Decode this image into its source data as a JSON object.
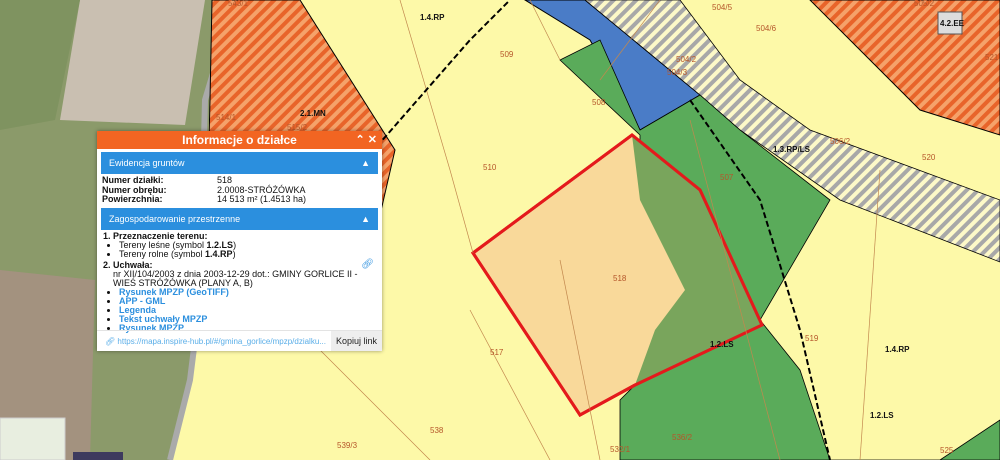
{
  "panel": {
    "title": "Informacje o działce",
    "controls": "⌃✕",
    "ewidencja": {
      "header": "Ewidencja gruntów",
      "rows": [
        {
          "key": "Numer działki:",
          "value": "518"
        },
        {
          "key": "Numer obrębu:",
          "value": "2.0008-STRÓŻÓWKA"
        },
        {
          "key": "Powierzchnia:",
          "value": "14 513 m² (1.4513 ha)"
        }
      ]
    },
    "zagospodarowanie": {
      "header": "Zagospodarowanie przestrzenne",
      "przeznaczenie_label": "1.  Przeznaczenie terenu:",
      "przeznaczenie": [
        {
          "text": "Tereny leśne (symbol ",
          "symbol": "1.2.LS",
          "end": ")"
        },
        {
          "text": "Tereny rolne (symbol ",
          "symbol": "1.4.RP",
          "end": ")"
        }
      ],
      "uchwala_label": "2.  Uchwała:",
      "uchwala_text": "nr XII/104/2003 z dnia 2003-12-29 dot.: GMINY GORLICE II - WIEŚ STRÓŻÓWKA (PLANY A, B)",
      "links": [
        "Rysunek MPZP (GeoTIFF)",
        "APP - GML",
        "Legenda",
        "Tekst uchwały MPZP",
        "Rysunek MPZP"
      ]
    },
    "url": "https://mapa.inspire-hub.pl/#/gmina_gorlice/mpzp/dzialku...",
    "copy_label": "Kopiuj link"
  },
  "map": {
    "zone_labels": [
      "1.4.RP",
      "2.1.MN",
      "1.3.RP/LS",
      "1.2.LS",
      "1.4.RP",
      "1.2.LS",
      "4.2.EE"
    ],
    "parcel_labels": [
      "509",
      "508",
      "510",
      "507",
      "518",
      "517",
      "519",
      "520",
      "506/2",
      "504/5",
      "504/6",
      "504/2",
      "504/3",
      "505/2",
      "521",
      "539/3",
      "538",
      "532/1",
      "536/2",
      "525",
      "515/2",
      "514/1",
      "543/1"
    ],
    "colors": {
      "selected_parcel": "#e41a1c",
      "forest": "#5aab5a",
      "agricultural": "#fdf9a8",
      "residential": "#f07f3c",
      "water": "#4a7cc7",
      "panel_header": "#f26522",
      "section_header": "#2b8fde"
    }
  }
}
